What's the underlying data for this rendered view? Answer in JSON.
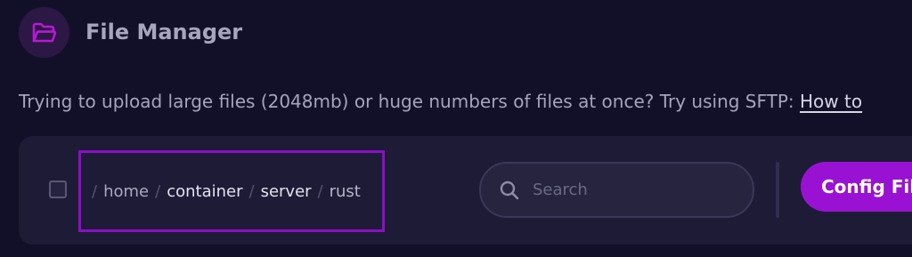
{
  "header": {
    "title": "File Manager",
    "icon": "folder-open-icon",
    "icon_color": "#b818d8"
  },
  "notice": {
    "text": "Trying to upload large files (2048mb) or huge numbers of files at once? Try using SFTP: ",
    "link_text": "How to"
  },
  "breadcrumb": {
    "separator": "/",
    "home": "home",
    "segments": [
      "container",
      "server"
    ],
    "current": "rust"
  },
  "search": {
    "placeholder": "Search",
    "value": ""
  },
  "toolbar": {
    "config_button_label": "Config Files"
  },
  "colors": {
    "accent": "#9912d4",
    "background": "#121028",
    "panel": "#1d1b36",
    "highlight_border": "#8c0fc6"
  }
}
